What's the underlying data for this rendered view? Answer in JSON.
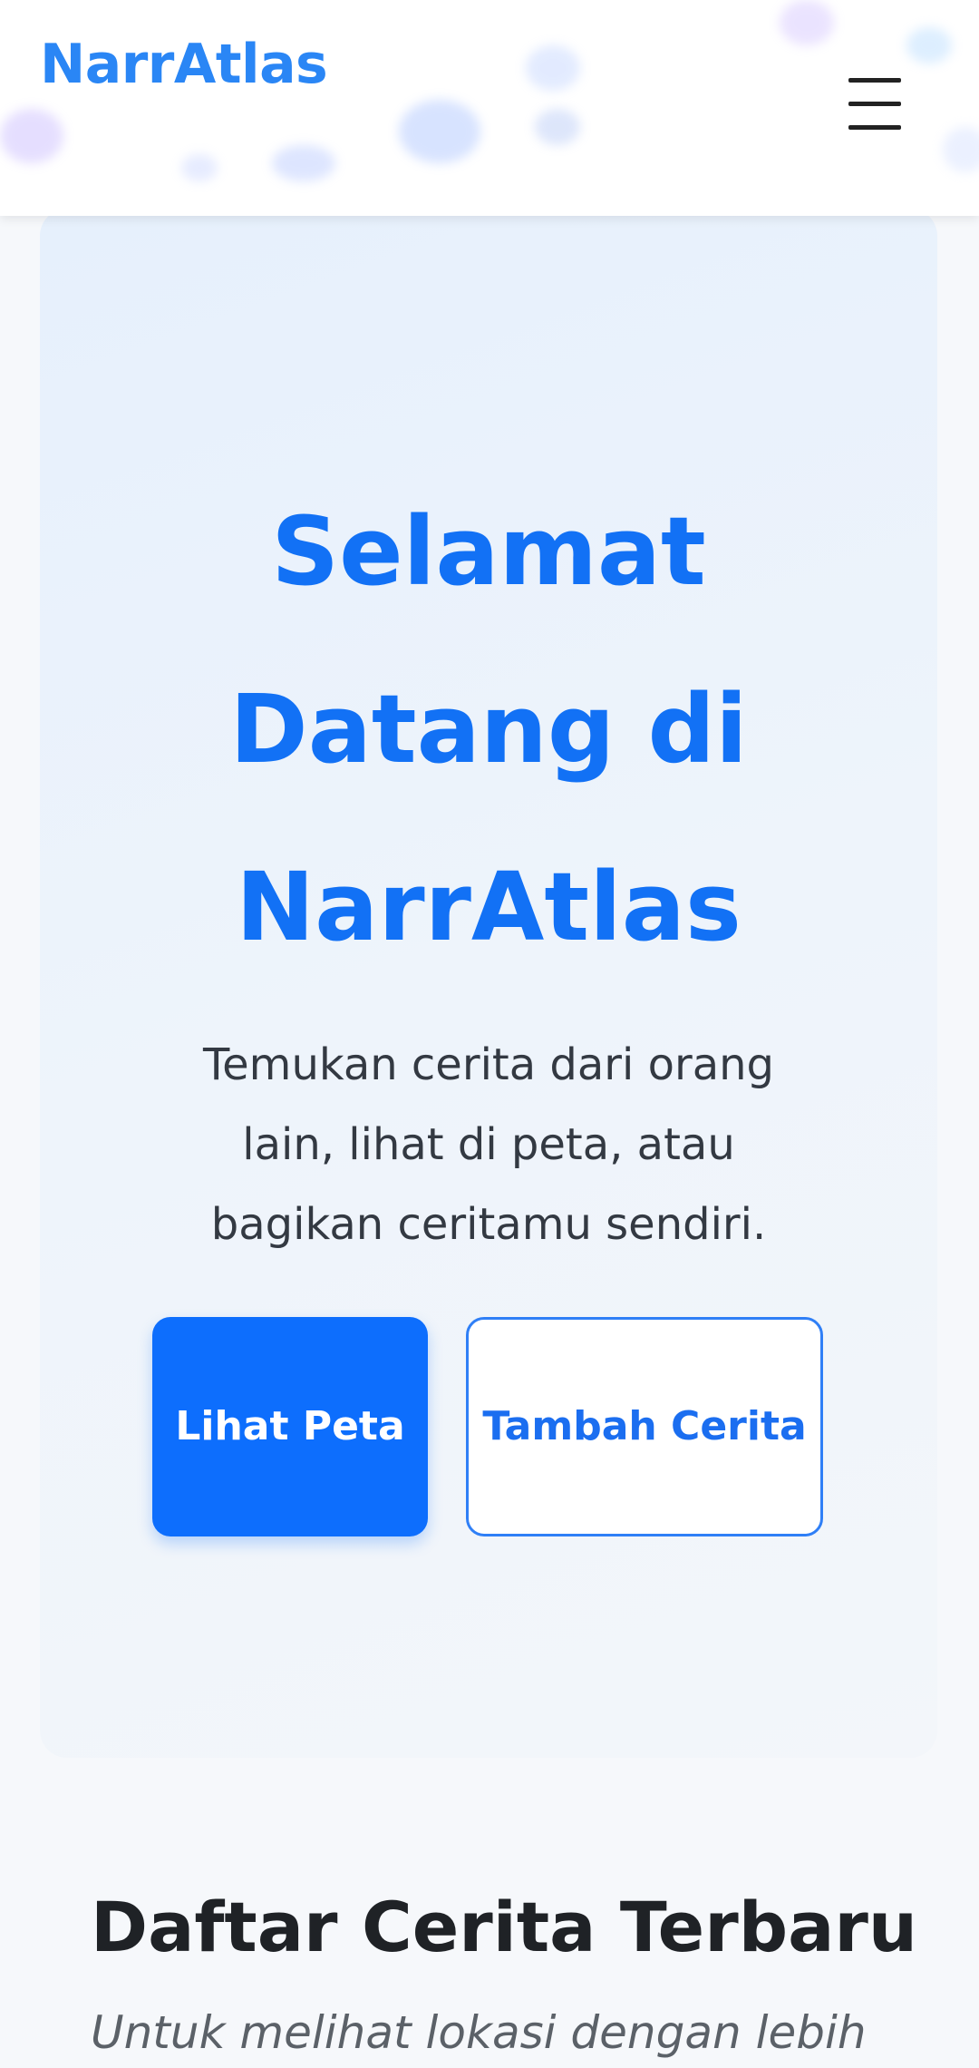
{
  "header": {
    "logo": "NarrAtlas",
    "menu_icon": "hamburger-menu-icon"
  },
  "hero": {
    "title": "Selamat Datang di NarrAtlas",
    "subtitle": "Temukan cerita dari orang lain, lihat di peta, atau bagikan ceritamu sendiri.",
    "primary_button": "Lihat Peta",
    "secondary_button": "Tambah Cerita"
  },
  "stories": {
    "title": "Daftar Cerita Terbaru",
    "note": "Untuk melihat lokasi dengan lebih"
  },
  "colors": {
    "brand": "#2a86f5",
    "primary": "#0d6efd",
    "hero_bg": "#e6f0fc",
    "text_dark": "#1f2226"
  }
}
